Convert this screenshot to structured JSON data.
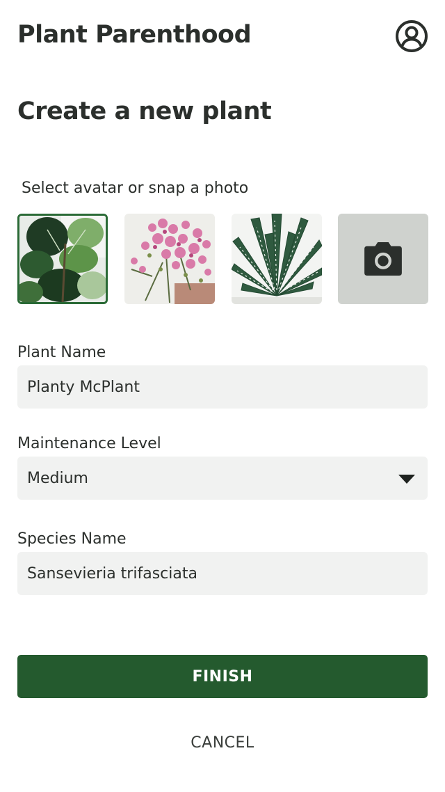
{
  "header": {
    "app_title": "Plant Parenthood",
    "profile_icon": "user-circle-icon"
  },
  "page": {
    "title": "Create a new plant"
  },
  "avatars": {
    "label": "Select avatar or snap a photo",
    "items": [
      {
        "name": "fiddle-leaf-fig",
        "selected": true
      },
      {
        "name": "pink-flowering-plant",
        "selected": false
      },
      {
        "name": "zebra-haworthia",
        "selected": false
      },
      {
        "name": "camera",
        "icon": "camera-icon",
        "selected": false
      }
    ],
    "selected_color": "#2a6a36"
  },
  "form": {
    "plant_name_label": "Plant Name",
    "plant_name_value": "Planty McPlant",
    "maintenance_label": "Maintenance Level",
    "maintenance_value": "Medium",
    "species_label": "Species Name",
    "species_value": "Sansevieria trifasciata"
  },
  "actions": {
    "finish_label": "FINISH",
    "cancel_label": "CANCEL",
    "finish_color": "#245a2e"
  }
}
